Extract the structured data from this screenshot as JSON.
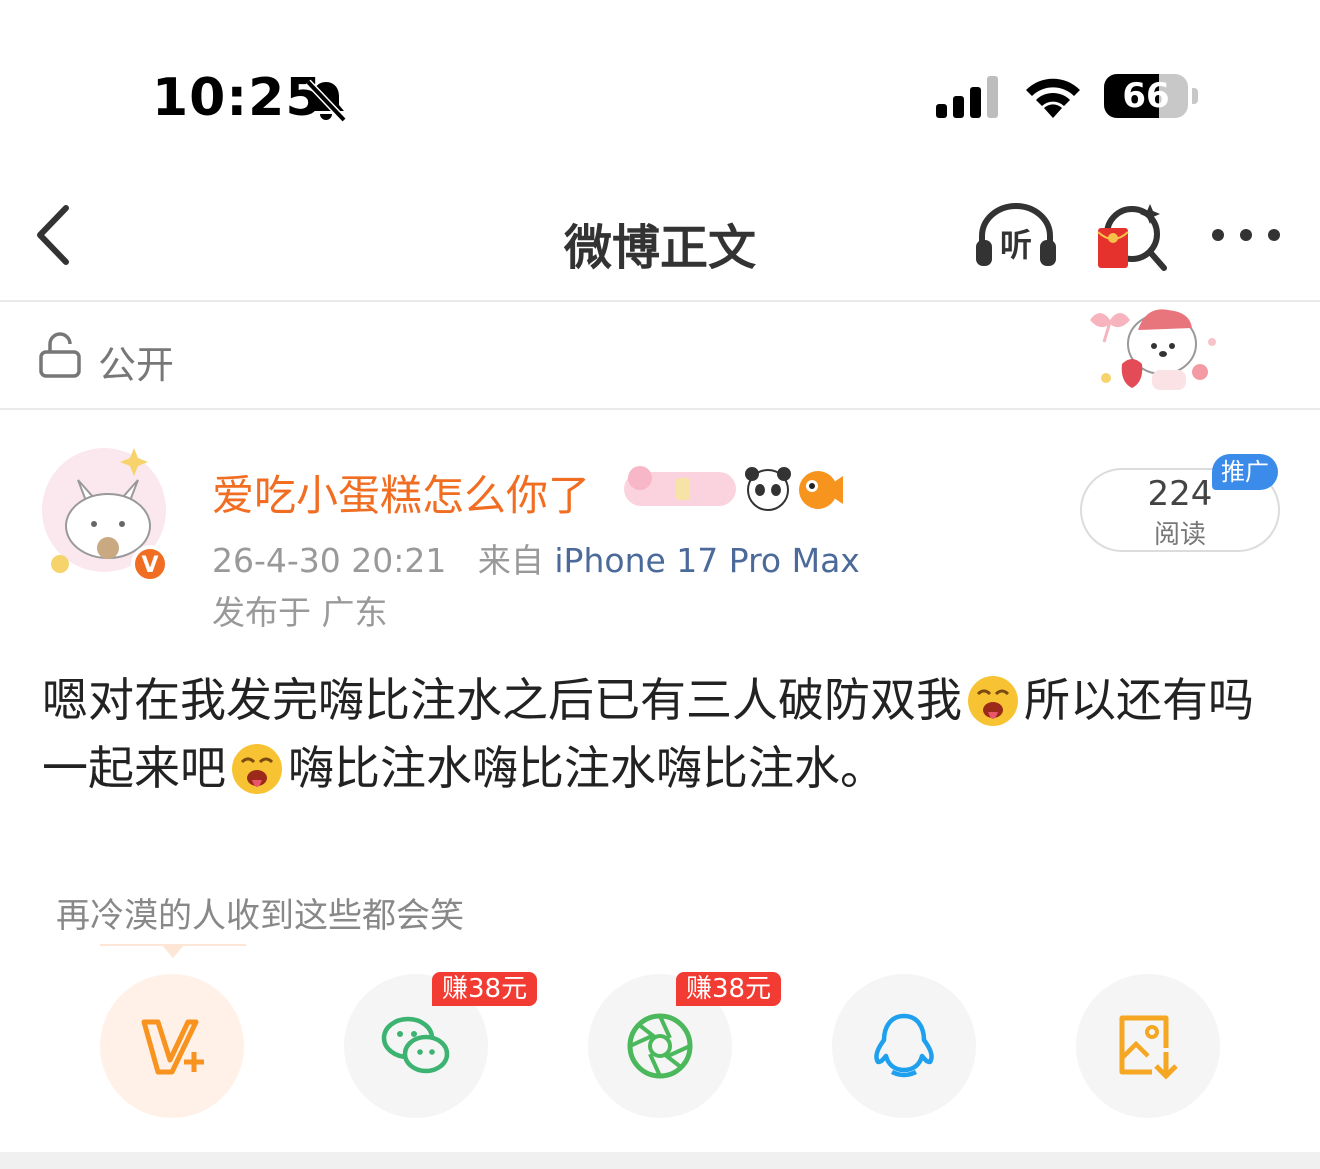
{
  "status_bar": {
    "time": "10:25",
    "battery": "66",
    "battery_level": 0.66
  },
  "nav": {
    "title": "微博正文"
  },
  "visibility": {
    "label": "公开"
  },
  "author": {
    "name": "爱吃小蛋糕怎么你了",
    "verified_badge": "V",
    "date": "26-4-30 20:21",
    "source_prefix": "来自",
    "device": "iPhone 17 Pro Max",
    "location": "发布于 广东"
  },
  "stats": {
    "read_count": "224",
    "read_label": "阅读",
    "promo_tag": "推广"
  },
  "post": {
    "segment_1": "嗯对在我发完嗨比注水之后已有三人破防双我",
    "segment_2": "所以还有吗一起来吧",
    "segment_3": "嗨比注水嗨比注水嗨比注水。"
  },
  "share": {
    "tip": "再冷漠的人收到这些都会笑",
    "earn_badge_wechat": "赚38元",
    "earn_badge_moments": "赚38元"
  },
  "colors": {
    "accent_orange": "#f06d21",
    "device_blue": "#4b6a9a",
    "promo_blue": "#3a8bea",
    "earn_red": "#f23c33"
  }
}
